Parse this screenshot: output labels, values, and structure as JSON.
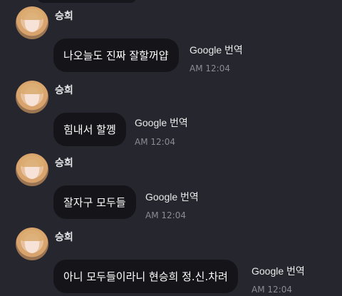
{
  "messages": [
    {
      "sender": "승희",
      "text": "나오늘도 진짜 잘할꺼얍",
      "translate_label": "Google 번역",
      "time": "AM 12:04"
    },
    {
      "sender": "승희",
      "text": "힘내서 할껭",
      "translate_label": "Google 번역",
      "time": "AM 12:04"
    },
    {
      "sender": "승희",
      "text": "잘자구 모두들",
      "translate_label": "Google 번역",
      "time": "AM 12:04"
    },
    {
      "sender": "승희",
      "text": "아니 모두들이라니 현승희 정.신.차려",
      "translate_label": "Google 번역",
      "time": "AM 12:04"
    }
  ],
  "colors": {
    "background": "#25262e",
    "bubble": "#141419",
    "timestamp": "#8b8c93"
  }
}
